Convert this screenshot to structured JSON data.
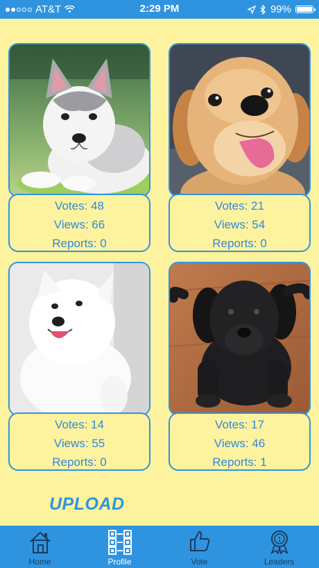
{
  "status_bar": {
    "carrier": "AT&T",
    "time": "2:29 PM",
    "battery_percent": "99%",
    "battery_level": 0.99,
    "signal_bars_filled": 2
  },
  "dogs": [
    {
      "breed_visual": "husky-puppy",
      "votes": "Votes: 48",
      "views": "Views: 66",
      "reports": "Reports: 0"
    },
    {
      "breed_visual": "golden-puppy",
      "votes": "Votes: 21",
      "views": "Views: 54",
      "reports": "Reports: 0"
    },
    {
      "breed_visual": "samoyed-puppy",
      "votes": "Votes: 14",
      "views": "Views: 55",
      "reports": "Reports: 0"
    },
    {
      "breed_visual": "black-lab-puppy",
      "votes": "Votes: 17",
      "views": "Views: 46",
      "reports": "Reports: 1"
    }
  ],
  "upload_label": "UPLOAD",
  "tabs": [
    {
      "label": "Home",
      "icon": "house-icon"
    },
    {
      "label": "Profile",
      "icon": "qr-grid-icon",
      "active": true
    },
    {
      "label": "Vote",
      "icon": "thumbs-up-icon"
    },
    {
      "label": "Leaders",
      "icon": "medal-icon"
    }
  ],
  "colors": {
    "accent": "#2F94E0",
    "background": "#FDF39F",
    "text_blue": "#2F88E0"
  }
}
